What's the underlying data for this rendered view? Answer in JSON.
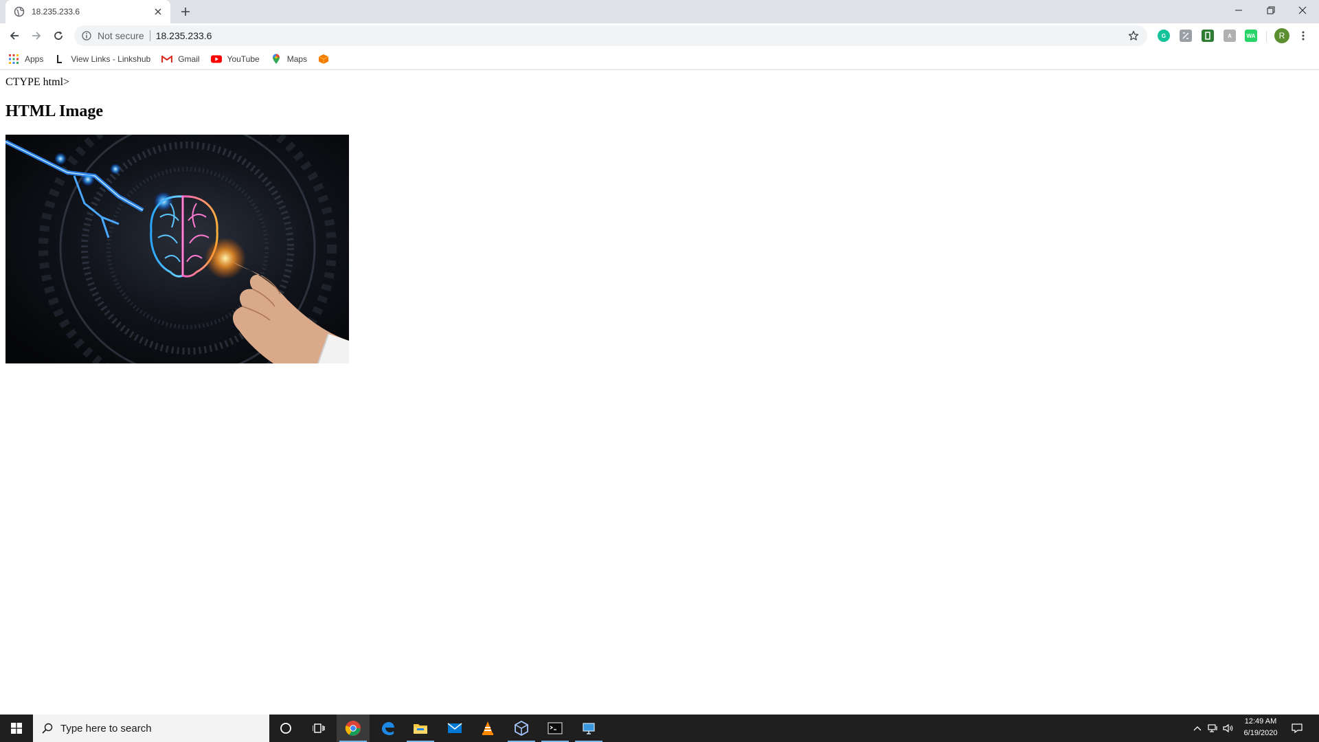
{
  "browser": {
    "tab": {
      "title": "18.235.233.6"
    },
    "omnibox": {
      "security_label": "Not secure",
      "url": "18.235.233.6"
    },
    "profile_initial": "R",
    "extensions": [
      {
        "name": "grammarly-icon",
        "color": "#15c39a"
      },
      {
        "name": "extension-icon",
        "color": "#9aa0a6"
      },
      {
        "name": "extension-green-icon",
        "color": "#2e7d32"
      },
      {
        "name": "extension-gray-icon",
        "color": "#b0b0b0"
      },
      {
        "name": "whatsapp-icon",
        "color": "#25d366",
        "label": "WA"
      }
    ]
  },
  "bookmarks": {
    "apps": "Apps",
    "linkshub": "View Links - Linkshub",
    "gmail": "Gmail",
    "youtube": "YouTube",
    "maps": "Maps"
  },
  "page": {
    "doctype_text": "CTYPE html>",
    "heading": "HTML Image"
  },
  "taskbar": {
    "search_placeholder": "Type here to search",
    "time": "12:49 AM",
    "date": "6/19/2020",
    "accent_color": "#76b9ed"
  }
}
